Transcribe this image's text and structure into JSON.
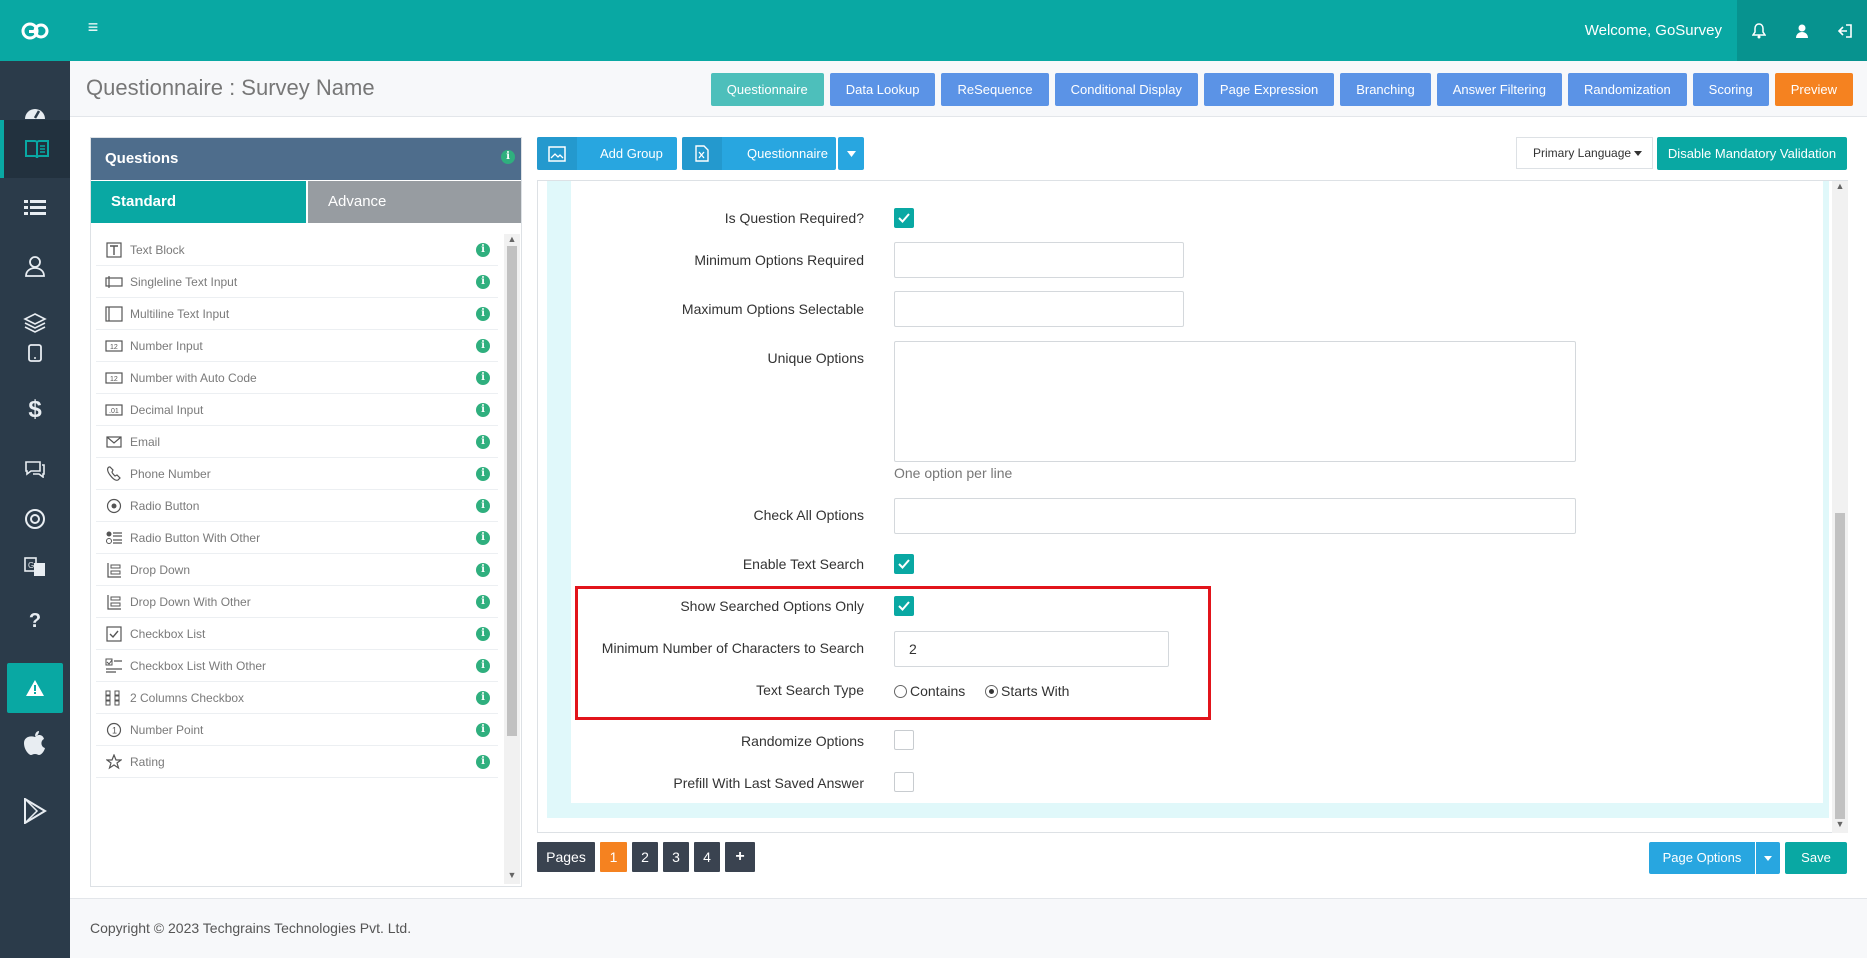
{
  "topbar": {
    "welcome": "Welcome, GoSurvey"
  },
  "header": {
    "title": "Questionnaire : Survey Name",
    "buttons": [
      {
        "label": "Questionnaire",
        "color": "#4dbfbb"
      },
      {
        "label": "Data Lookup",
        "color": "#5b93e6"
      },
      {
        "label": "ReSequence",
        "color": "#5b93e6"
      },
      {
        "label": "Conditional Display",
        "color": "#5b93e6"
      },
      {
        "label": "Page Expression",
        "color": "#5b93e6"
      },
      {
        "label": "Branching",
        "color": "#5b93e6"
      },
      {
        "label": "Answer Filtering",
        "color": "#5b93e6"
      },
      {
        "label": "Randomization",
        "color": "#5b93e6"
      },
      {
        "label": "Scoring",
        "color": "#5b93e6"
      },
      {
        "label": "Preview",
        "color": "#f58220"
      }
    ]
  },
  "questions_panel": {
    "title": "Questions",
    "tabs": [
      "Standard",
      "Advance"
    ],
    "items": [
      {
        "label": "Text Block",
        "icon": "text-block-icon"
      },
      {
        "label": "Singleline Text Input",
        "icon": "singleline-input-icon"
      },
      {
        "label": "Multiline Text Input",
        "icon": "multiline-input-icon"
      },
      {
        "label": "Number Input",
        "icon": "number-input-icon"
      },
      {
        "label": "Number with Auto Code",
        "icon": "number-auto-code-icon"
      },
      {
        "label": "Decimal Input",
        "icon": "decimal-input-icon"
      },
      {
        "label": "Email",
        "icon": "email-icon"
      },
      {
        "label": "Phone Number",
        "icon": "phone-icon"
      },
      {
        "label": "Radio Button",
        "icon": "radio-button-icon"
      },
      {
        "label": "Radio Button With Other",
        "icon": "radio-other-icon"
      },
      {
        "label": "Drop Down",
        "icon": "drop-down-icon"
      },
      {
        "label": "Drop Down With Other",
        "icon": "drop-down-other-icon"
      },
      {
        "label": "Checkbox List",
        "icon": "checkbox-icon"
      },
      {
        "label": "Checkbox List With Other",
        "icon": "checkbox-other-icon"
      },
      {
        "label": "2 Columns Checkbox",
        "icon": "two-column-checkbox-icon"
      },
      {
        "label": "Number Point",
        "icon": "number-point-icon"
      },
      {
        "label": "Rating",
        "icon": "star-icon"
      }
    ]
  },
  "toolbar": {
    "add_group": "Add Group",
    "questionnaire": "Questionnaire",
    "language": "Primary Language",
    "disable_validation": "Disable Mandatory Validation"
  },
  "form": {
    "is_required_label": "Is Question Required?",
    "is_required": true,
    "min_options_label": "Minimum Options Required",
    "min_options_value": "",
    "max_options_label": "Maximum Options Selectable",
    "max_options_value": "",
    "unique_options_label": "Unique Options",
    "unique_options_help": "One option per line",
    "check_all_label": "Check All Options",
    "enable_search_label": "Enable Text Search",
    "enable_search": true,
    "show_searched_label": "Show Searched Options Only",
    "show_searched": true,
    "min_chars_label": "Minimum Number of Characters to Search",
    "min_chars_value": "2",
    "search_type_label": "Text Search Type",
    "search_type_options": [
      "Contains",
      "Starts With"
    ],
    "search_type_selected": "Starts With",
    "randomize_label": "Randomize Options",
    "randomize": false,
    "prefill_label": "Prefill With Last Saved Answer",
    "prefill": false
  },
  "pagination": {
    "label": "Pages",
    "pages": [
      "1",
      "2",
      "3",
      "4"
    ],
    "current": "1",
    "add": "+",
    "page_options": "Page Options",
    "save": "Save"
  },
  "footer": {
    "copyright": "Copyright © 2023 Techgrains Technologies Pvt. Ltd."
  }
}
